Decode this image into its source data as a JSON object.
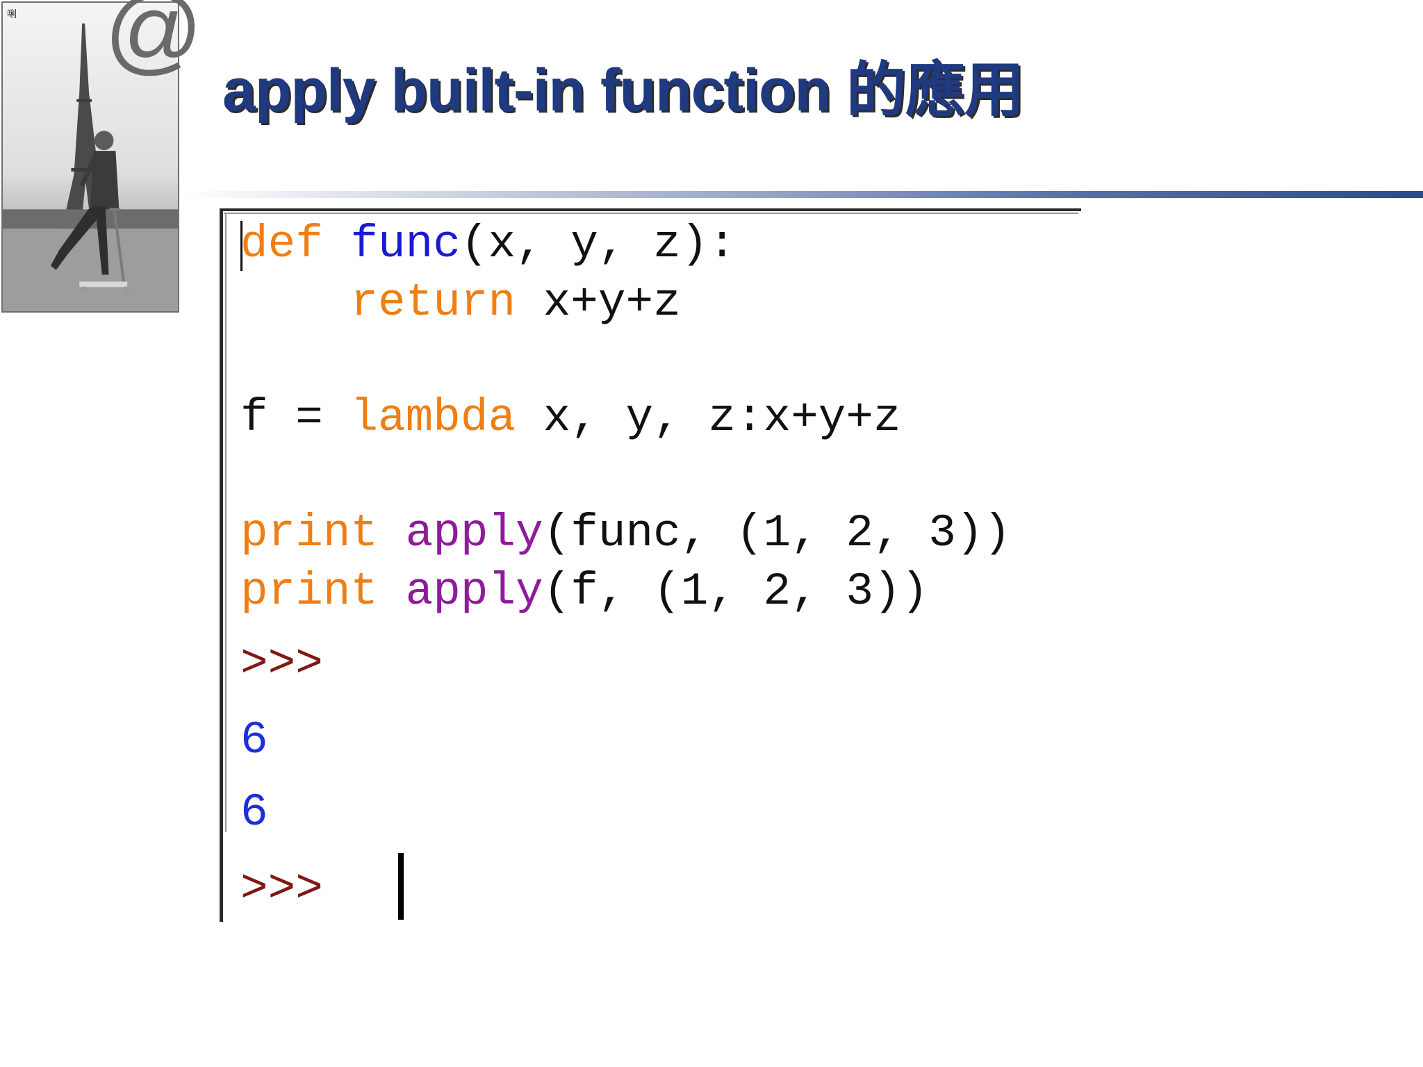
{
  "slide": {
    "title": "apply built-in function 的應用",
    "corner_glyph": "唎",
    "at_symbol": "@"
  },
  "photo": {
    "description_icon": "eiffel-tower-scooter-photo"
  },
  "code": {
    "line1": {
      "keyword": "def",
      "func_name": "func",
      "rest": "(x, y, z):"
    },
    "line2": {
      "indent": "    ",
      "keyword": "return",
      "rest": " x+y+z"
    },
    "line3": {
      "lhs": "f = ",
      "keyword": "lambda",
      "rest": " x, y, z:x+y+z"
    },
    "line4": {
      "keyword": "print",
      "builtin": "apply",
      "rest": "(func, (1, 2, 3))"
    },
    "line5": {
      "keyword": "print",
      "builtin": "apply",
      "rest": "(f, (1, 2, 3))"
    }
  },
  "shell": {
    "prompt1": ">>>",
    "output1": "6",
    "output2": "6",
    "prompt2": ">>>"
  },
  "colors": {
    "title": "#1f3a80",
    "keyword": "#ef7e14",
    "function_name": "#1a1ad1",
    "builtin": "#8f1a9c",
    "prompt": "#7d1a14",
    "output": "#1a2fd6"
  }
}
